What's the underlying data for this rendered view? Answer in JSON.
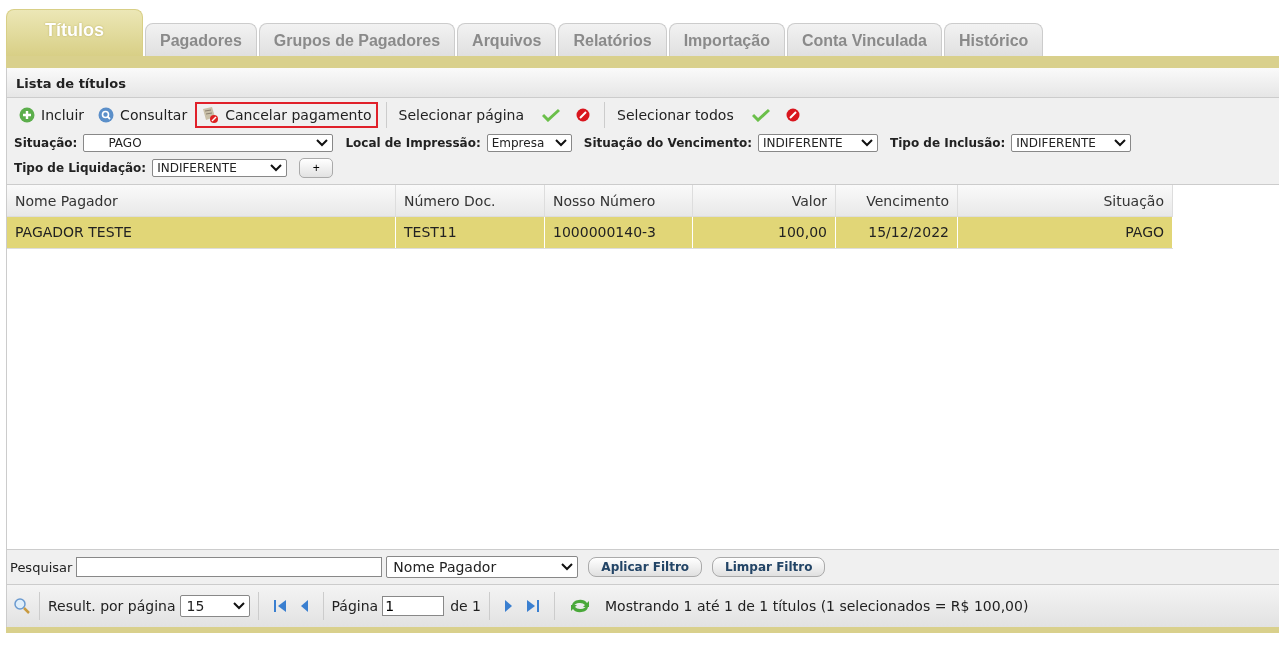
{
  "tabs": [
    {
      "label": "Títulos",
      "selected": true
    },
    {
      "label": "Pagadores",
      "selected": false
    },
    {
      "label": "Grupos de Pagadores",
      "selected": false
    },
    {
      "label": "Arquivos",
      "selected": false
    },
    {
      "label": "Relatórios",
      "selected": false
    },
    {
      "label": "Importação",
      "selected": false
    },
    {
      "label": "Conta Vinculada",
      "selected": false
    },
    {
      "label": "Histórico",
      "selected": false
    }
  ],
  "panel": {
    "title": "Lista de títulos"
  },
  "toolbar": [
    {
      "kind": "action",
      "label": "Incluir",
      "highlighted": false
    },
    {
      "kind": "action",
      "label": "Consultar",
      "highlighted": false
    },
    {
      "kind": "action",
      "label": "Cancelar pagamento",
      "highlighted": true
    },
    {
      "kind": "select",
      "label": "Selecionar página"
    },
    {
      "kind": "select",
      "label": "Selecionar todos"
    }
  ],
  "filters": [
    {
      "label": "Situação:",
      "value": "PAGO"
    },
    {
      "label": "Local de Impressão:",
      "value": "Empresa"
    },
    {
      "label": "Situação do Vencimento:",
      "value": "INDIFERENTE"
    },
    {
      "label": "Tipo de Inclusão:",
      "value": "INDIFERENTE"
    },
    {
      "label": "Tipo de Liquidação:",
      "value": "INDIFERENTE"
    }
  ],
  "add_filter": "+",
  "table": {
    "columns": [
      "Nome Pagador",
      "Número Doc.",
      "Nosso Número",
      "Valor",
      "Vencimento",
      "Situação"
    ],
    "rows": [
      {
        "selected": true,
        "cells": [
          "PAGADOR TESTE",
          "TEST11",
          "1000000140-3",
          "100,00",
          "15/12/2022",
          "PAGO"
        ]
      }
    ]
  },
  "search": {
    "label": "Pesquisar",
    "field": "Nome Pagador",
    "buttons": [
      "Aplicar Filtro",
      "Limpar Filtro"
    ]
  },
  "pager": {
    "per_page_label": "Result. por página",
    "per_page": "15",
    "page_label": "Página",
    "page": "1",
    "of": "de 1",
    "status": "Mostrando 1 até 1 de 1 títulos (1 selecionados = R$ 100,00)"
  }
}
